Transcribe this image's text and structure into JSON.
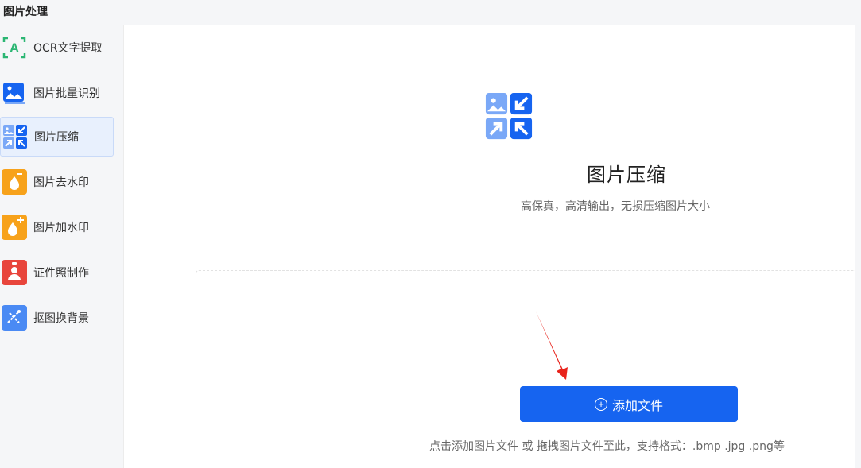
{
  "section_title": "图片处理",
  "sidebar": {
    "items": [
      {
        "label": "OCR文字提取",
        "icon": "ocr-a-icon"
      },
      {
        "label": "图片批量识别",
        "icon": "image-icon"
      },
      {
        "label": "图片压缩",
        "icon": "compress-icon"
      },
      {
        "label": "图片去水印",
        "icon": "remove-watermark-icon"
      },
      {
        "label": "图片加水印",
        "icon": "add-watermark-icon"
      },
      {
        "label": "证件照制作",
        "icon": "id-photo-icon"
      },
      {
        "label": "抠图换背景",
        "icon": "cutout-icon"
      }
    ],
    "active_index": 2
  },
  "main": {
    "title": "图片压缩",
    "subtitle": "高保真，高清输出，无损压缩图片大小",
    "add_button_label": "添加文件",
    "hint": "点击添加图片文件 或 拖拽图片文件至此，支持格式：.bmp .jpg .png等"
  },
  "colors": {
    "primary": "#1664f0",
    "accent_light": "#7aa8f7",
    "orange": "#f7a21b",
    "red": "#e8453c",
    "annotation_red": "#e8231b"
  }
}
